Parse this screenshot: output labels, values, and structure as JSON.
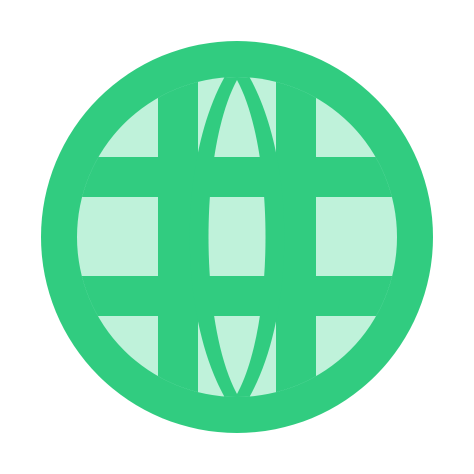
{
  "icon": {
    "name": "globe-icon",
    "colors": {
      "outline": "#31CC80",
      "fill": "#BFF2DA",
      "background": "#FFFFFF"
    }
  }
}
